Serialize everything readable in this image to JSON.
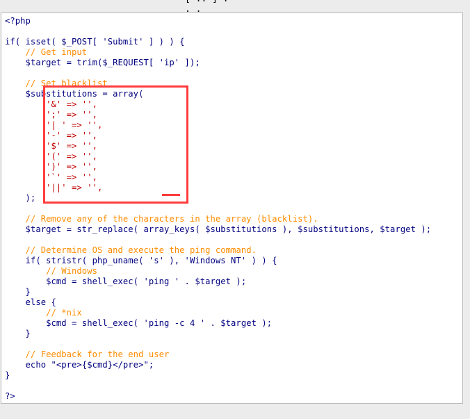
{
  "top_fragment": "[ .. ] . . .",
  "code_lines": [
    "<?php",
    "",
    "if( isset( $_POST[ 'Submit' ] ) ) {",
    "    // Get input",
    "    $target = trim($_REQUEST[ 'ip' ]);",
    "",
    "    // Set blacklist",
    "    $substitutions = array(",
    "        '&' => '',",
    "        ';' => '',",
    "        '| ' => '',",
    "        '-' => '',",
    "        '$' => '',",
    "        '(' => '',",
    "        ')' => '',",
    "        '`' => '',",
    "        '||' => '',",
    "    );",
    "",
    "    // Remove any of the characters in the array (blacklist).",
    "    $target = str_replace( array_keys( $substitutions ), $substitutions, $target );",
    "",
    "    // Determine OS and execute the ping command.",
    "    if( stristr( php_uname( 's' ), 'Windows NT' ) ) {",
    "        // Windows",
    "        $cmd = shell_exec( 'ping ' . $target );",
    "    }",
    "    else {",
    "        // *nix",
    "        $cmd = shell_exec( 'ping -c 4 ' . $target );",
    "    }",
    "",
    "    // Feedback for the end user",
    "    echo \"<pre>{$cmd}</pre>\";",
    "}",
    "",
    "?>"
  ],
  "highlight": {
    "label": "",
    "color": "#ff3c3c"
  }
}
